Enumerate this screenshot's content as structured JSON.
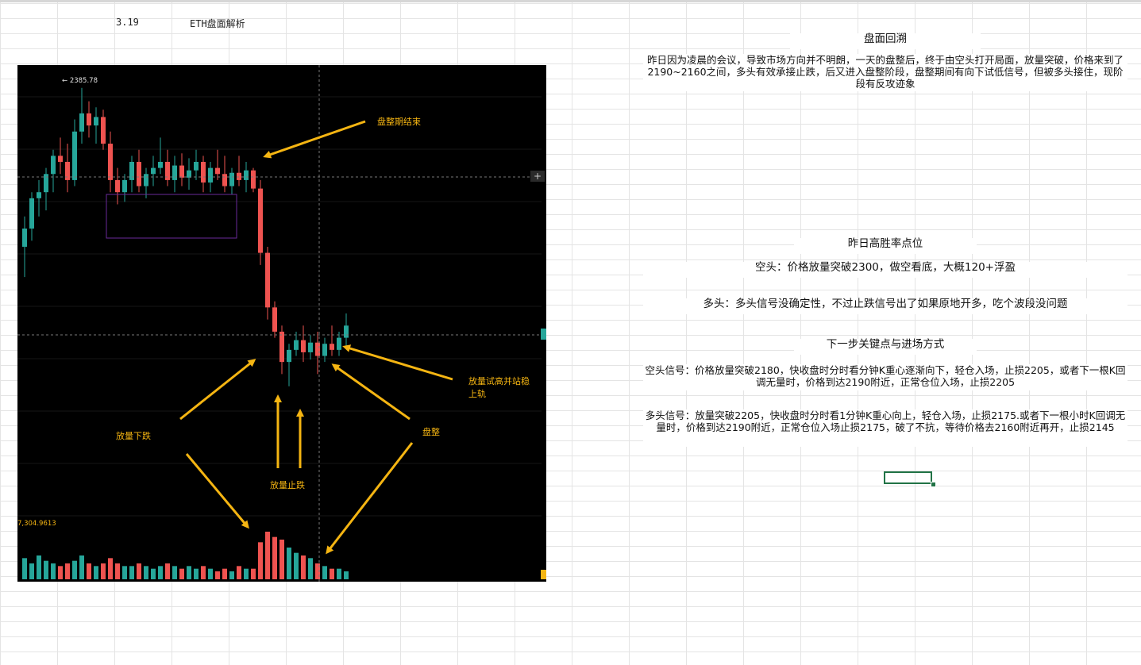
{
  "sheet": {
    "date_cell": "3.19",
    "title_cell": "ETH盘面解析"
  },
  "chart": {
    "high_label": "← 2385.78",
    "volume_label": "7,304.9613",
    "annotations": {
      "consolidation_end": "盘整期结束",
      "volume_drop": "放量下跌",
      "volume_stop": "放量止跌",
      "consolidation": "盘整",
      "test_high_line1": "放量试高并站稳",
      "test_high_line2": "上轨"
    },
    "colors": {
      "up": "#26a69a",
      "down": "#ef5350",
      "arrow": "#f5b512",
      "annotation_text": "#f5b512",
      "box": "#6a2a9a",
      "background": "#000000"
    }
  },
  "chart_data": {
    "type": "candlestick",
    "instrument": "ETH",
    "annotated_high": 2385.78,
    "volume_max_label": 7304.9613,
    "candles": [
      [
        2255,
        2280,
        2230,
        2270
      ],
      [
        2270,
        2300,
        2260,
        2295
      ],
      [
        2295,
        2310,
        2280,
        2300
      ],
      [
        2300,
        2320,
        2285,
        2315
      ],
      [
        2315,
        2335,
        2300,
        2330
      ],
      [
        2330,
        2345,
        2315,
        2325
      ],
      [
        2325,
        2340,
        2300,
        2310
      ],
      [
        2310,
        2360,
        2305,
        2350
      ],
      [
        2350,
        2386,
        2340,
        2365
      ],
      [
        2365,
        2375,
        2345,
        2355
      ],
      [
        2355,
        2370,
        2340,
        2362
      ],
      [
        2362,
        2368,
        2335,
        2340
      ],
      [
        2340,
        2350,
        2300,
        2310
      ],
      [
        2310,
        2320,
        2290,
        2300
      ],
      [
        2300,
        2315,
        2292,
        2310
      ],
      [
        2310,
        2330,
        2300,
        2325
      ],
      [
        2325,
        2335,
        2300,
        2305
      ],
      [
        2305,
        2320,
        2295,
        2315
      ],
      [
        2315,
        2330,
        2305,
        2320
      ],
      [
        2320,
        2345,
        2315,
        2325
      ],
      [
        2325,
        2335,
        2305,
        2310
      ],
      [
        2310,
        2330,
        2300,
        2322
      ],
      [
        2322,
        2332,
        2305,
        2312
      ],
      [
        2312,
        2328,
        2302,
        2318
      ],
      [
        2318,
        2335,
        2310,
        2325
      ],
      [
        2325,
        2330,
        2300,
        2308
      ],
      [
        2308,
        2325,
        2300,
        2320
      ],
      [
        2320,
        2335,
        2310,
        2315
      ],
      [
        2315,
        2330,
        2300,
        2305
      ],
      [
        2305,
        2320,
        2298,
        2316
      ],
      [
        2316,
        2330,
        2305,
        2310
      ],
      [
        2310,
        2325,
        2300,
        2318
      ],
      [
        2318,
        2320,
        2300,
        2303
      ],
      [
        2303,
        2310,
        2240,
        2250
      ],
      [
        2250,
        2255,
        2195,
        2205
      ],
      [
        2205,
        2210,
        2180,
        2185
      ],
      [
        2185,
        2190,
        2150,
        2160
      ],
      [
        2160,
        2175,
        2140,
        2170
      ],
      [
        2170,
        2185,
        2165,
        2178
      ],
      [
        2178,
        2190,
        2160,
        2168
      ],
      [
        2168,
        2182,
        2162,
        2176
      ],
      [
        2176,
        2185,
        2150,
        2165
      ],
      [
        2165,
        2180,
        2160,
        2175
      ],
      [
        2175,
        2190,
        2165,
        2170
      ],
      [
        2170,
        2185,
        2165,
        2180
      ],
      [
        2180,
        2200,
        2172,
        2190
      ]
    ],
    "volume": [
      8,
      6,
      9,
      7,
      6,
      5,
      6,
      7,
      9,
      6,
      5,
      6,
      8,
      6,
      5,
      5,
      6,
      5,
      4,
      5,
      6,
      5,
      4,
      5,
      4,
      5,
      4,
      3,
      4,
      3,
      5,
      4,
      4,
      14,
      18,
      16,
      15,
      12,
      10,
      9,
      8,
      6,
      5,
      4,
      4,
      3
    ]
  },
  "panel": {
    "review_title": "盘面回溯",
    "review_text": "昨日因为凌晨的会议，导致市场方向并不明朗，一天的盘整后，终于由空头打开局面，放量突破，价格来到了2190~2160之间，多头有效承接止跌，后又进入盘整阶段，盘整期间有向下试低信号，但被多头接住，现阶段有反攻迹象",
    "winrate_title": "昨日高胜率点位",
    "short_line": "空头：价格放量突破2300，做空看底，大概120+浮盈",
    "long_line": "多头：多头信号没确定性，不过止跌信号出了如果原地开多，吃个波段没问题",
    "next_title": "下一步关键点与进场方式",
    "short_signal": "空头信号：价格放量突破2180，快收盘时分时看分钟K重心逐渐向下，轻仓入场，止损2205，或者下一根K回调无量时，价格到达2190附近，正常仓位入场，止损2205",
    "long_signal": "多头信号：放量突破2205，快收盘时分时看1分钟K重心向上，轻仓入场，止损2175.或者下一根小时K回调无量时，价格到达2190附近，正常仓位入场止损2175，破了不抗，等待价格去2160附近再开，止损2145"
  }
}
